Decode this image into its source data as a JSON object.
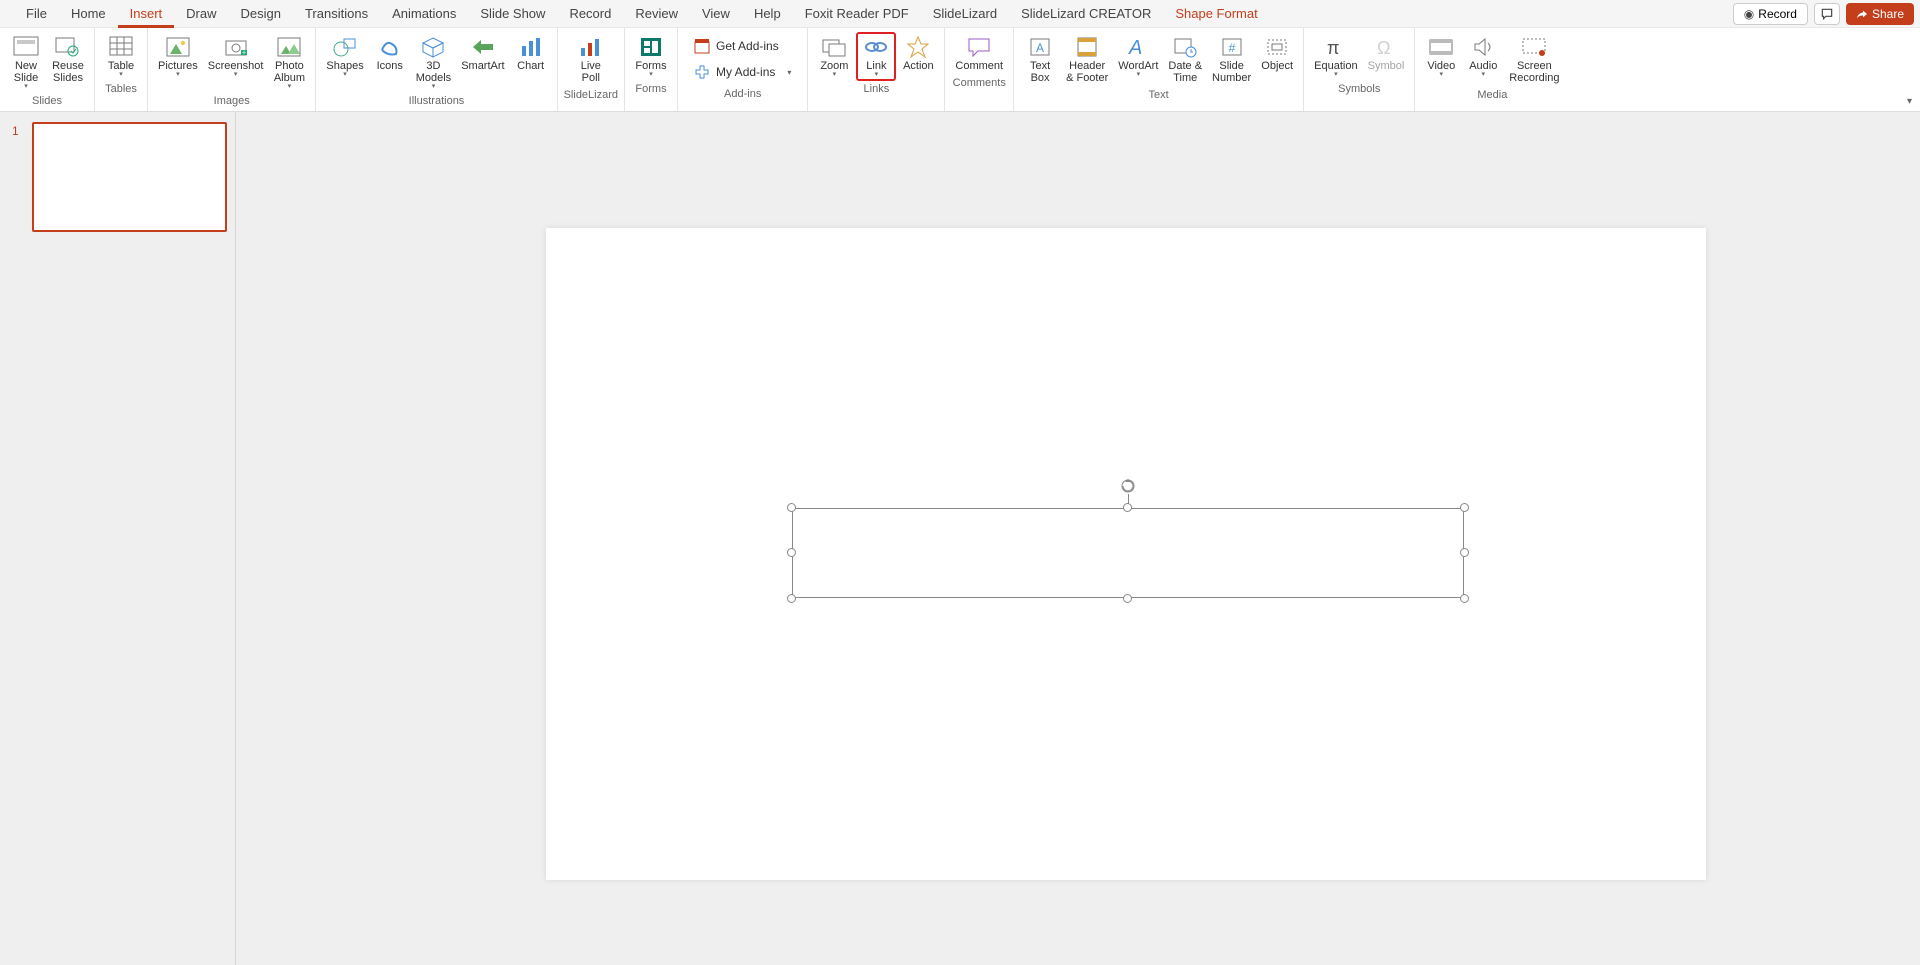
{
  "menu": {
    "tabs": [
      "File",
      "Home",
      "Insert",
      "Draw",
      "Design",
      "Transitions",
      "Animations",
      "Slide Show",
      "Record",
      "Review",
      "View",
      "Help",
      "Foxit Reader PDF",
      "SlideLizard",
      "SlideLizard CREATOR",
      "Shape Format"
    ],
    "active": "Insert",
    "record": "Record",
    "share": "Share"
  },
  "ribbon": {
    "groups": {
      "slides": {
        "label": "Slides",
        "newSlide": "New\nSlide",
        "reuse": "Reuse\nSlides"
      },
      "tables": {
        "label": "Tables",
        "table": "Table"
      },
      "images": {
        "label": "Images",
        "pictures": "Pictures",
        "screenshot": "Screenshot",
        "photoAlbum": "Photo\nAlbum"
      },
      "illustrations": {
        "label": "Illustrations",
        "shapes": "Shapes",
        "icons": "Icons",
        "models": "3D\nModels",
        "smartart": "SmartArt",
        "chart": "Chart"
      },
      "slidelizard": {
        "label": "SlideLizard",
        "livepoll": "Live\nPoll"
      },
      "forms": {
        "label": "Forms",
        "forms": "Forms"
      },
      "addins": {
        "label": "Add-ins",
        "get": "Get Add-ins",
        "my": "My Add-ins"
      },
      "links": {
        "label": "Links",
        "zoom": "Zoom",
        "link": "Link",
        "action": "Action"
      },
      "comments": {
        "label": "Comments",
        "comment": "Comment"
      },
      "text": {
        "label": "Text",
        "textbox": "Text\nBox",
        "header": "Header\n& Footer",
        "wordart": "WordArt",
        "date": "Date &\nTime",
        "slidenum": "Slide\nNumber",
        "object": "Object"
      },
      "symbols": {
        "label": "Symbols",
        "equation": "Equation",
        "symbol": "Symbol"
      },
      "media": {
        "label": "Media",
        "video": "Video",
        "audio": "Audio",
        "screenrec": "Screen\nRecording"
      }
    }
  },
  "thumbs": {
    "first": "1"
  }
}
